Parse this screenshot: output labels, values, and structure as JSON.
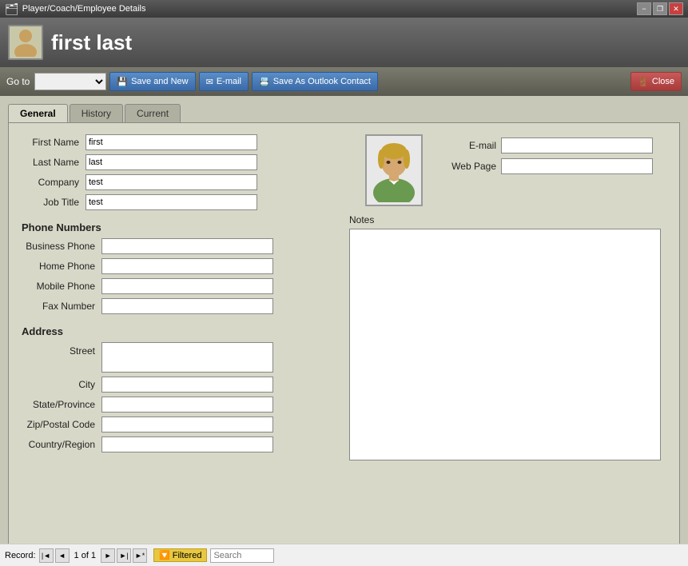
{
  "titlebar": {
    "title": "Player/Coach/Employee Details",
    "min": "−",
    "restore": "❐",
    "close": "✕"
  },
  "header": {
    "name": "first last",
    "icon": "👤"
  },
  "toolbar": {
    "goto_label": "Go to",
    "goto_placeholder": "",
    "save_new_label": "Save and New",
    "email_label": "E-mail",
    "save_outlook_label": "Save As Outlook Contact",
    "close_label": "Close"
  },
  "tabs": [
    {
      "label": "General",
      "active": true
    },
    {
      "label": "History",
      "active": false
    },
    {
      "label": "Current",
      "active": false
    }
  ],
  "form": {
    "first_name_label": "First Name",
    "first_name_value": "first",
    "last_name_label": "Last Name",
    "last_name_value": "last",
    "company_label": "Company",
    "company_value": "test",
    "job_title_label": "Job Title",
    "job_title_value": "test",
    "phone_numbers_header": "Phone Numbers",
    "business_phone_label": "Business Phone",
    "business_phone_value": "",
    "home_phone_label": "Home Phone",
    "home_phone_value": "",
    "mobile_phone_label": "Mobile Phone",
    "mobile_phone_value": "",
    "fax_number_label": "Fax Number",
    "fax_number_value": "",
    "address_header": "Address",
    "street_label": "Street",
    "street_value": "",
    "city_label": "City",
    "city_value": "",
    "state_label": "State/Province",
    "state_value": "",
    "zip_label": "Zip/Postal Code",
    "zip_value": "",
    "country_label": "Country/Region",
    "country_value": "",
    "email_label": "E-mail",
    "email_value": "",
    "web_page_label": "Web Page",
    "web_page_value": "",
    "notes_label": "Notes"
  },
  "statusbar": {
    "record_label": "Record:",
    "record_of": "1 of 1",
    "filtered_label": "Filtered",
    "search_label": "Search"
  }
}
